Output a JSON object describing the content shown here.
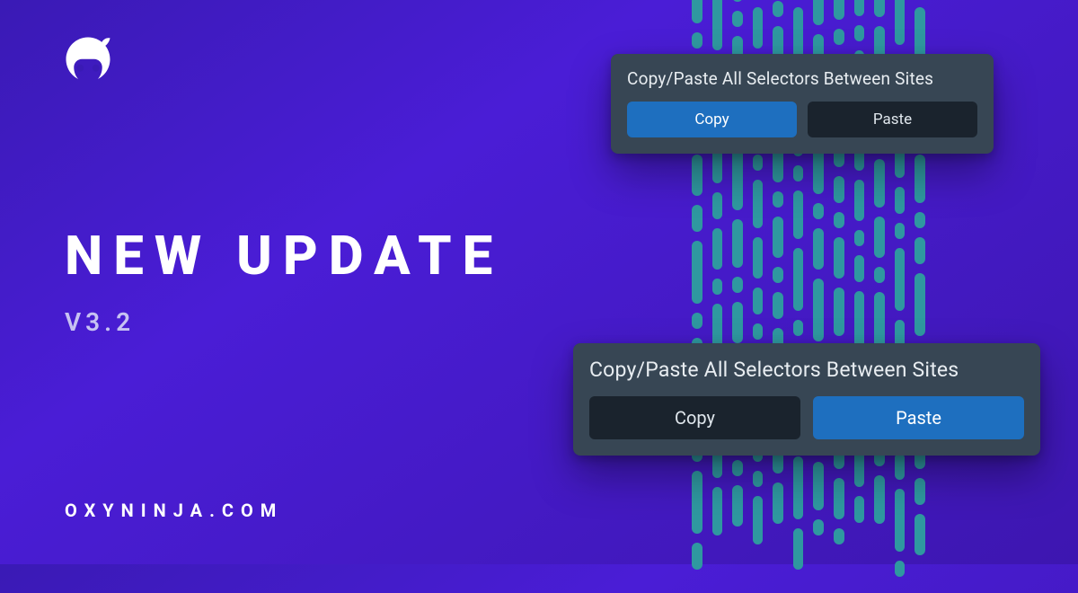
{
  "headline": "NEW UPDATE",
  "version": "V3.2",
  "brand": "OXYNINJA.COM",
  "panel_top": {
    "title": "Copy/Paste All Selectors Between Sites",
    "copy_label": "Copy",
    "paste_label": "Paste",
    "active": "copy"
  },
  "panel_bottom": {
    "title": "Copy/Paste All Selectors Between Sites",
    "copy_label": "Copy",
    "paste_label": "Paste",
    "active": "paste"
  },
  "colors": {
    "bg_gradient_from": "#3a1ab5",
    "bg_gradient_to": "#3d16b0",
    "accent_blue": "#1e6fbf",
    "accent_teal": "#2f98a0",
    "panel_bg": "#374654",
    "btn_dark": "#1a232d"
  }
}
